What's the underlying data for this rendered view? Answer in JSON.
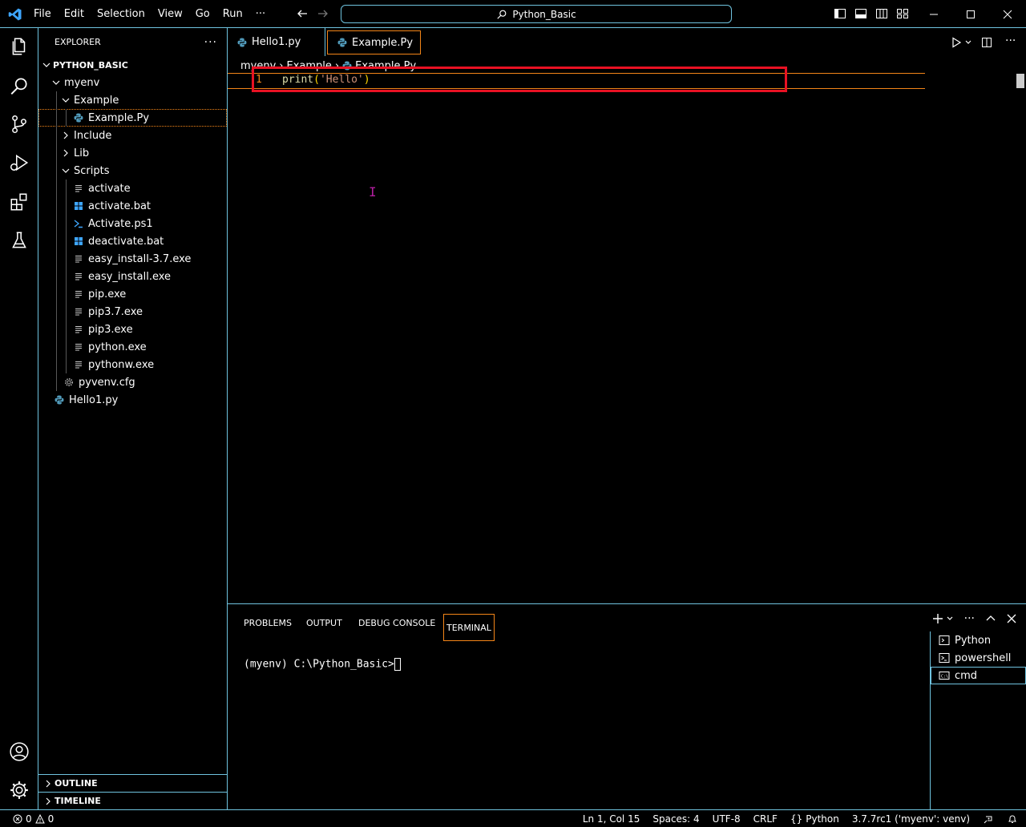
{
  "window": {
    "title": "Python_Basic"
  },
  "menu": [
    "File",
    "Edit",
    "Selection",
    "View",
    "Go",
    "Run",
    "···"
  ],
  "explorer": {
    "header": "EXPLORER",
    "root": "PYTHON_BASIC",
    "items": [
      {
        "label": "myenv",
        "icon": "chevron-down",
        "depth": 1
      },
      {
        "label": "Example",
        "icon": "chevron-down",
        "depth": 2
      },
      {
        "label": "Example.Py",
        "icon": "python",
        "depth": 3
      },
      {
        "label": "Include",
        "icon": "chevron-right",
        "depth": 2
      },
      {
        "label": "Lib",
        "icon": "chevron-right",
        "depth": 2
      },
      {
        "label": "Scripts",
        "icon": "chevron-down",
        "depth": 2
      },
      {
        "label": "activate",
        "icon": "file-lines",
        "depth": 3
      },
      {
        "label": "activate.bat",
        "icon": "windows",
        "depth": 3
      },
      {
        "label": "Activate.ps1",
        "icon": "powershell",
        "depth": 3
      },
      {
        "label": "deactivate.bat",
        "icon": "windows",
        "depth": 3
      },
      {
        "label": "easy_install-3.7.exe",
        "icon": "file-lines",
        "depth": 3
      },
      {
        "label": "easy_install.exe",
        "icon": "file-lines",
        "depth": 3
      },
      {
        "label": "pip.exe",
        "icon": "file-lines",
        "depth": 3
      },
      {
        "label": "pip3.7.exe",
        "icon": "file-lines",
        "depth": 3
      },
      {
        "label": "pip3.exe",
        "icon": "file-lines",
        "depth": 3
      },
      {
        "label": "python.exe",
        "icon": "file-lines",
        "depth": 3
      },
      {
        "label": "pythonw.exe",
        "icon": "file-lines",
        "depth": 3
      },
      {
        "label": "pyvenv.cfg",
        "icon": "gear",
        "depth": 2
      },
      {
        "label": "Hello1.py",
        "icon": "python",
        "depth": 1
      }
    ],
    "outline": "OUTLINE",
    "timeline": "TIMELINE"
  },
  "tabs": [
    {
      "label": "Hello1.py"
    },
    {
      "label": "Example.Py"
    }
  ],
  "breadcrumb": [
    "myenv",
    "Example",
    "Example.Py"
  ],
  "editor": {
    "line_number": "1",
    "code_fn": "print",
    "code_open": "(",
    "code_str": "'Hello'",
    "code_close": ")"
  },
  "panel": {
    "tabs": [
      "PROBLEMS",
      "OUTPUT",
      "DEBUG CONSOLE",
      "TERMINAL"
    ],
    "terminal_prompt": "(myenv) C:\\Python_Basic>",
    "terminals": [
      "Python",
      "powershell",
      "cmd"
    ]
  },
  "status": {
    "errors": "0",
    "warnings": "0",
    "position": "Ln 1, Col 15",
    "spaces": "Spaces: 4",
    "encoding": "UTF-8",
    "eol": "CRLF",
    "language": "Python",
    "interpreter": "3.7.7rc1 ('myenv': venv)"
  },
  "colors": {
    "accent_border": "#6fc3df",
    "active_border": "#f38518",
    "highlight_box": "#e81123"
  }
}
